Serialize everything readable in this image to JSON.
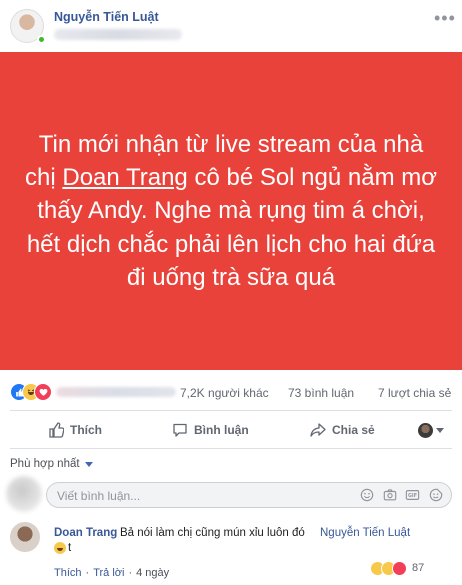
{
  "post": {
    "author": "Nguyễn Tiến Luật",
    "more_icon": "more-dots-icon",
    "banner": {
      "background": "#e9423b",
      "text_before": "Tin mới nhận từ live stream của nhà chị ",
      "mention": "Doan Trang",
      "text_after": " cô bé Sol ngủ nằm mơ thấy Andy. Nghe mà rụng tim á chời, hết dịch chắc phải lên lịch cho hai đứa đi uống trà sữa quá"
    }
  },
  "reactions": {
    "icons": [
      "like-reaction-icon",
      "haha-reaction-icon",
      "love-reaction-icon"
    ],
    "others": "7,2K người khác",
    "comments": "73 bình luận",
    "shares": "7 lượt chia sẻ"
  },
  "actions": {
    "like": "Thích",
    "comment": "Bình luận",
    "share": "Chia sẻ"
  },
  "comments_section": {
    "sort_label": "Phù hợp nhất",
    "composer_placeholder": "Viết bình luận...",
    "composer_tools": [
      "emoji-icon",
      "camera-icon",
      "gif-icon",
      "sticker-icon"
    ]
  },
  "comment": {
    "author": "Doan Trang",
    "text": "Bả nói làm chị cũng mún xỉu luôn đó",
    "mention": "Nguyễn Tiến Luật",
    "second_line": "t",
    "like_label": "Thích",
    "reply_label": "Trả lời",
    "time": "4 ngày",
    "reaction_count": "87"
  },
  "colors": {
    "accent": "#365899",
    "banner": "#e9423b",
    "like_blue": "#2078f4",
    "love_red": "#f33e58",
    "haha_yellow": "#f7c94b"
  }
}
